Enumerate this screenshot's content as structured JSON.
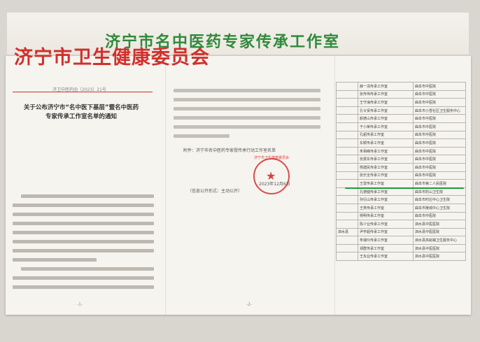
{
  "banner": {
    "title": "济宁市名中医药专家传承工作室"
  },
  "page1": {
    "header": "济宁市卫生健康委员会",
    "doc_no": "济卫中医药函〔2023〕21号",
    "title": "关于公布济宁市“名中医下基层”暨名中医药专家传承工作室名单的通知",
    "page_num": "-1-"
  },
  "page2": {
    "attachment": "附件：济宁市名中医药专家授传承行动工作室名单",
    "public_note": "（信息公开形式：主动公开）",
    "seal_text": "济宁市卫生健康委员会",
    "date": "2023年12月6日",
    "page_num": "-2-"
  },
  "table": {
    "rows": [
      {
        "c1": "",
        "c2": "薛一清传承工作室",
        "c3": "曲阜市中医院"
      },
      {
        "c1": "",
        "c2": "张传伟传承工作室",
        "c3": "曲阜市中医院"
      },
      {
        "c1": "",
        "c2": "王守海传承工作室",
        "c3": "曲阜市中医院"
      },
      {
        "c1": "",
        "c2": "孔令贤传承工作室",
        "c3": "曲阜市小雪社区卫生服务中心"
      },
      {
        "c1": "",
        "c2": "颜德山传承工作室",
        "c3": "曲阜市中医院"
      },
      {
        "c1": "",
        "c2": "于小荣传承工作室",
        "c3": "曲阜市中医院"
      },
      {
        "c1": "",
        "c2": "孔超传承工作室",
        "c3": "曲阜市中医院"
      },
      {
        "c1": "",
        "c2": "东颖传承工作室",
        "c3": "曲阜市中医院"
      },
      {
        "c1": "",
        "c2": "朱相峰传承工作室",
        "c3": "曲阜市中医院"
      },
      {
        "c1": "",
        "c2": "张振东传承工作室",
        "c3": "曲阜市中医院"
      },
      {
        "c1": "",
        "c2": "杨建民传承工作室",
        "c3": "曲阜市中医院"
      },
      {
        "c1": "",
        "c2": "张乐全传承工作室",
        "c3": "曲阜市中医院"
      },
      {
        "c1": "",
        "c2": "王雷传承工作室",
        "c3": "曲阜市第二人民医院"
      },
      {
        "c1": "",
        "c2": "孔德健传承工作室",
        "c3": "曲阜市防山卫生院"
      },
      {
        "c1": "",
        "c2": "孙衍山传承工作室",
        "c3": "曲阜市时庄中心卫生院"
      },
      {
        "c1": "",
        "c2": "王燕传承工作室",
        "c3": "曲阜市陵城中心卫生院"
      },
      {
        "c1": "",
        "c2": "杨明传承工作室",
        "c3": "曲阜市中医院"
      },
      {
        "c1": "",
        "c2": "陈少业传承工作室",
        "c3": "泗水县中医医院"
      },
      {
        "c1": "泗水县",
        "c2": "尹学超传承工作室",
        "c3": "泗水县中医医院"
      },
      {
        "c1": "",
        "c2": "朱瑞玲传承工作室",
        "c3": "泗水县高峪镇卫生服务中心"
      },
      {
        "c1": "",
        "c2": "郑群传承工作室",
        "c3": "泗水县中医医院"
      },
      {
        "c1": "",
        "c2": "王永业传承工作室",
        "c3": "泗水县中医医院"
      }
    ]
  }
}
